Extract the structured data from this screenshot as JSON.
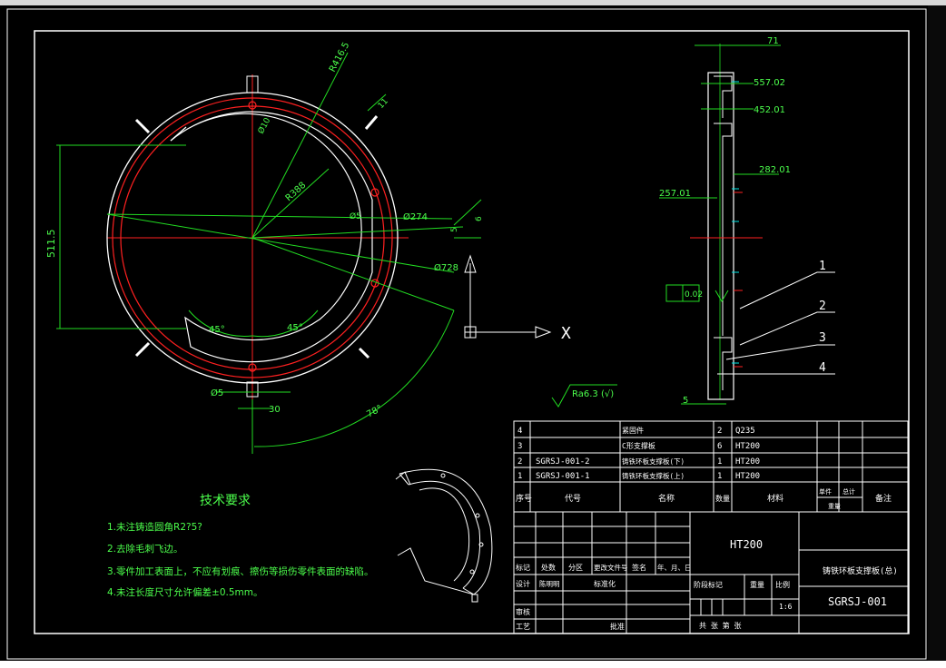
{
  "colors": {
    "background": "#000000",
    "frame": "#ffffff",
    "dimension": "#22dd22",
    "part_outline": "#ff2020",
    "part_edge": "#ffffff",
    "note_text": "#4cff4c",
    "cyan": "#00e5e5",
    "yellow": "#ffff00"
  },
  "dimensions": {
    "r_outer": "R416.5",
    "tab_width": "11",
    "hole_dia": "Ø10",
    "r_mid": "R388",
    "dia_small": "Ø5",
    "dia_274": "Ø274",
    "dia_5": "5",
    "dia_728": "Ø728",
    "dia_6": "6",
    "offset_511": "511.5",
    "angle_45_left": "45°",
    "angle_45_right": "45°",
    "angle_78": "78°",
    "bottom_hole": "Ø5",
    "bottom_30": "30"
  },
  "axis": {
    "x_label": "X"
  },
  "side_view_dims": {
    "top": "71",
    "d557": "557.02",
    "d452": "452.01",
    "d282": "282.01",
    "d257": "257.01",
    "flatness": "0.02",
    "bottom": "5"
  },
  "balloons": [
    "1",
    "2",
    "3",
    "4"
  ],
  "roughness": "Ra6.3 (√)",
  "tech_req": {
    "title": "技术要求",
    "items": [
      "1.未注铸造圆角R2?5?",
      "2.去除毛刺飞边。",
      "3.零件加工表面上，不应有划痕、擦伤等损伤零件表面的缺陷。",
      "4.未注长度尺寸允许偏差±0.5mm。"
    ]
  },
  "bom": {
    "rows": [
      {
        "seq": "4",
        "code": "",
        "name": "紧固件",
        "qty": "2",
        "material": "Q235"
      },
      {
        "seq": "3",
        "code": "",
        "name": "C形支撑板",
        "qty": "6",
        "material": "HT200"
      },
      {
        "seq": "2",
        "code": "SGRSJ-001-2",
        "name": "铸铁环板支撑板(下)",
        "qty": "1",
        "material": "HT200"
      },
      {
        "seq": "1",
        "code": "SGRSJ-001-1",
        "name": "铸铁环板支撑板(上)",
        "qty": "1",
        "material": "HT200"
      }
    ],
    "header": {
      "seq": "序号",
      "code": "代号",
      "name": "名称",
      "qty": "数量",
      "material": "材料",
      "unit": "单件",
      "total": "总计",
      "weight": "重量",
      "remark": "备注"
    }
  },
  "title_block": {
    "material": "HT200",
    "part_name": "铸铁环板支撑板(总)",
    "drawing_no": "SGRSJ-001",
    "scale": "1:6",
    "labels": {
      "mark": "标记",
      "count": "处数",
      "zone": "分区",
      "change_doc": "更改文件号",
      "sign": "签名",
      "date": "年、月、日",
      "design": "设计",
      "designer": "陈明明",
      "standard": "标准化",
      "stage": "阶段标记",
      "weight": "重量",
      "ratio": "比例",
      "audit": "审核",
      "process": "工艺",
      "approve": "批准",
      "sheets": "共  张  第  张"
    }
  }
}
